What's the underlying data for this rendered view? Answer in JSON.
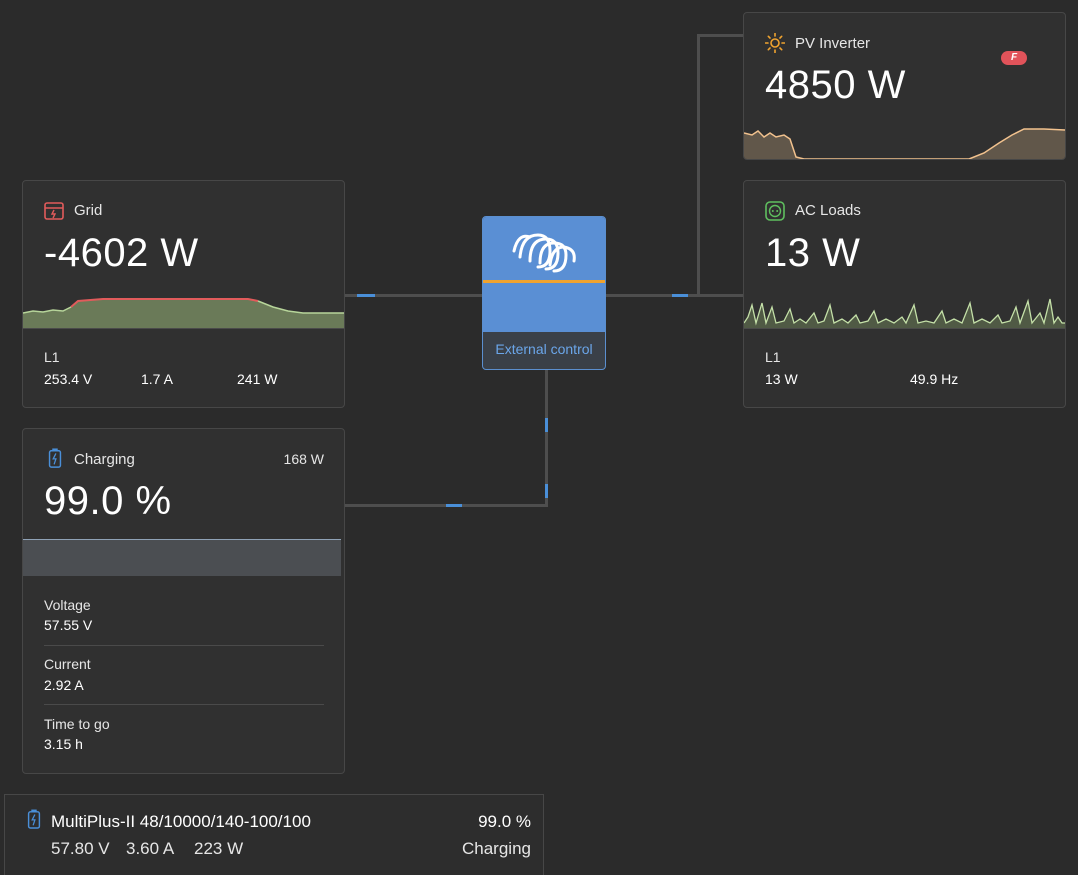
{
  "grid": {
    "title": "Grid",
    "power": "-4602 W",
    "phase_label": "L1",
    "voltage": "253.4 V",
    "current": "1.7 A",
    "phase_power": "241 W",
    "icon": "grid-meter-icon",
    "color": "#e15b5b"
  },
  "pv_inverter": {
    "title": "PV Inverter",
    "power": "4850 W",
    "icon": "sun-icon",
    "badge_icon": "fronius-logo-icon",
    "color": "#f0a32f"
  },
  "ac_loads": {
    "title": "AC Loads",
    "power": "13 W",
    "phase_label": "L1",
    "phase_power": "13 W",
    "frequency": "49.9 Hz",
    "icon": "socket-icon",
    "color": "#5fbf5f"
  },
  "battery": {
    "title": "Charging",
    "power": "168 W",
    "soc": "99.0 %",
    "soc_fraction": 0.99,
    "voltage_label": "Voltage",
    "voltage": "57.55 V",
    "current_label": "Current",
    "current": "2.92 A",
    "ttg_label": "Time to go",
    "ttg": "3.15 h",
    "icon": "battery-icon"
  },
  "inverter_device": {
    "label": "External control",
    "icon": "victron-logo-icon",
    "accent": "#5a8fd4"
  },
  "bottom_bar": {
    "device_name": "MultiPlus-II 48/10000/140-100/100",
    "voltage": "57.80 V",
    "current": "3.60 A",
    "power": "223 W",
    "soc": "99.0 %",
    "state": "Charging",
    "icon": "battery-icon"
  }
}
